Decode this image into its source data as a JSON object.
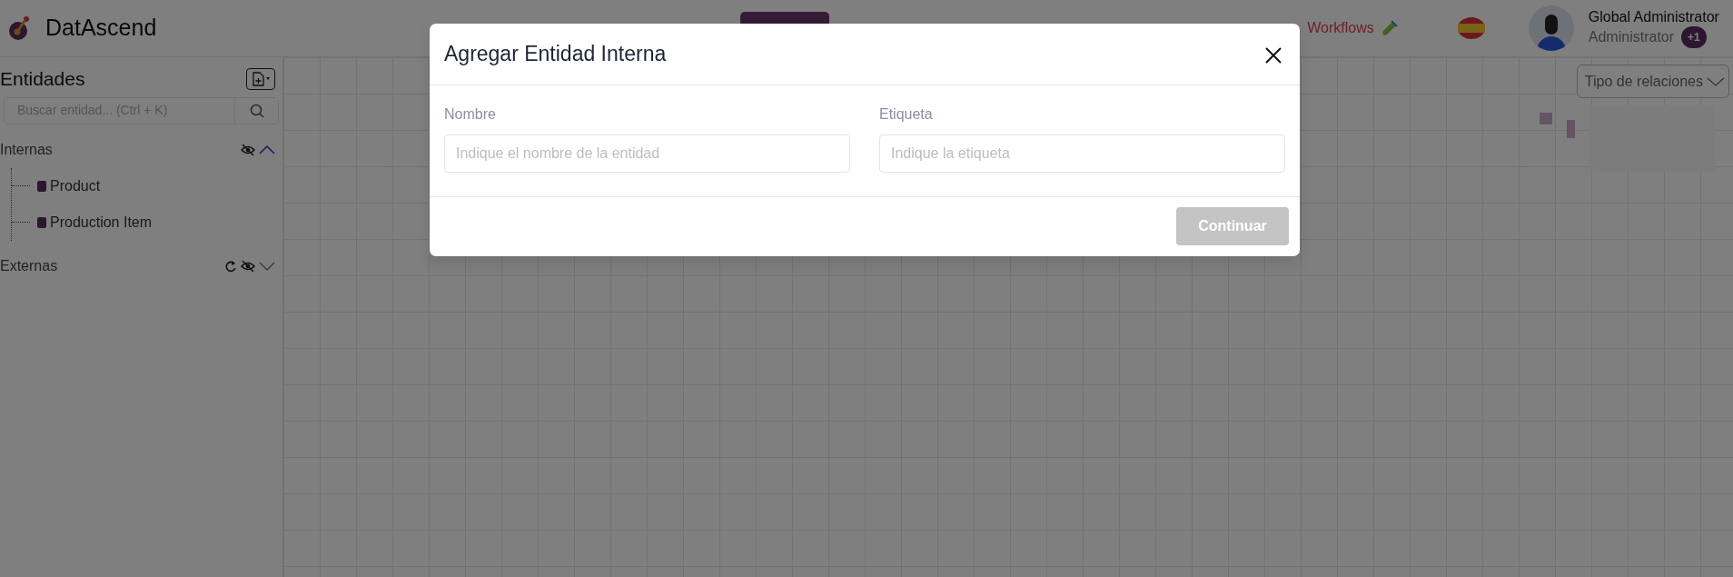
{
  "app": {
    "name": "DatAscend"
  },
  "nav": [
    {
      "kind": "hidden-tab",
      "selected": true
    },
    {
      "kind": "link",
      "label": "Workflows",
      "selected": false
    }
  ],
  "user": {
    "name": "Global Administrator",
    "role": "Administrator",
    "badge": "+1"
  },
  "sidebar": {
    "title": "Entidades",
    "search": {
      "placeholder": "Buscar entidad... (Ctrl + K)"
    },
    "groups": [
      {
        "label": "Internas",
        "expanded": true,
        "refreshable": false,
        "children": [
          {
            "label": "Product"
          },
          {
            "label": "Production Item"
          }
        ]
      },
      {
        "label": "Externas",
        "expanded": false,
        "refreshable": true
      }
    ]
  },
  "canvas": {
    "relation_filter": "Tipo de relaciones"
  },
  "modal": {
    "title": "Agregar Entidad Interna",
    "fields": [
      {
        "label": "Nombre",
        "placeholder": "Indique el nombre de la entidad"
      },
      {
        "label": "Etiqueta",
        "placeholder": "Indique la etiqueta"
      }
    ],
    "submit": {
      "label": "Continuar",
      "disabled": true
    }
  }
}
